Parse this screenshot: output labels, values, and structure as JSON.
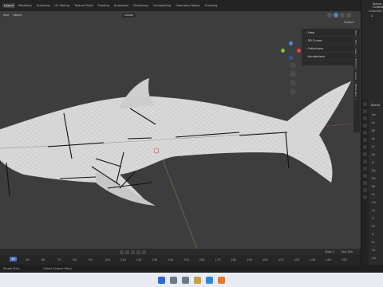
{
  "topbar": {
    "tabs": [
      "Layout",
      "Modeling",
      "Sculpting",
      "UV Editing",
      "Texture Paint",
      "Shading",
      "Animation",
      "Rendering",
      "Compositing",
      "Geometry Nodes",
      "Scripting"
    ],
    "active": "Layout"
  },
  "viewport_header": {
    "menu": [
      "Add",
      "Object"
    ],
    "transform": "Global",
    "options": "Options"
  },
  "npanel": {
    "items": [
      "View",
      "3D Cursor",
      "Collections",
      "Annotations"
    ],
    "tabs": [
      "Item",
      "Tool",
      "View",
      "3D-Print",
      "Create",
      "EDGE-Tools"
    ]
  },
  "outliner": {
    "title": "Scene Collection",
    "rows": [
      "Collection",
      "A"
    ]
  },
  "properties": {
    "title": "Scene",
    "items": [
      "Am",
      "Se",
      "Bk",
      "Sp",
      "Dr",
      "No",
      "Sl",
      "Dp",
      "Ws",
      "Ba",
      "Pe",
      "Fm",
      "Co",
      "Ti",
      "Sh",
      "Fr",
      "Dr",
      "Ov",
      "Col"
    ]
  },
  "timeline": {
    "current_frame": "44",
    "ticks": [
      "50",
      "60",
      "70",
      "80",
      "90",
      "100",
      "110",
      "120",
      "130",
      "140",
      "150",
      "160",
      "170",
      "180",
      "190",
      "200",
      "210",
      "220",
      "230",
      "240",
      "250"
    ],
    "start_label": "Start",
    "start": "1",
    "end_label": "End",
    "end": "250"
  },
  "status": {
    "left": "Rotate View",
    "middle": "Object Context Menu"
  },
  "colors": {
    "viewport": "#3d3d3d",
    "accent": "#4a72b8",
    "x_axis": "#e8474a",
    "y_axis": "#7fc33f",
    "z_axis": "#4d8be8"
  }
}
